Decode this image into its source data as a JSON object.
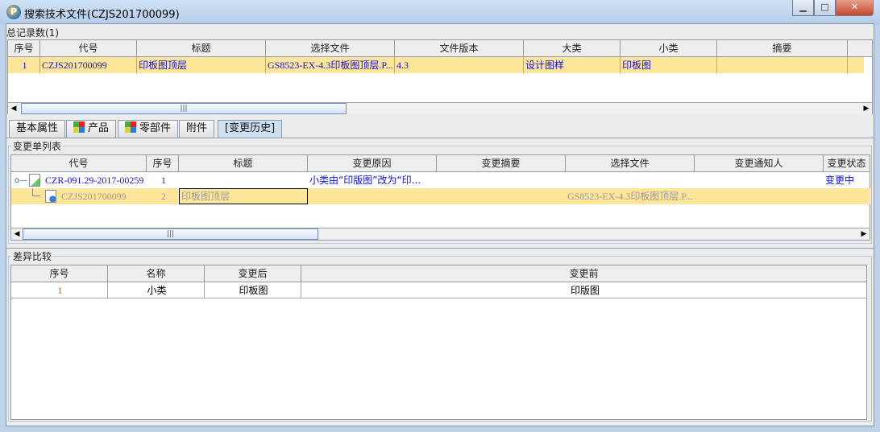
{
  "window": {
    "title": "搜索技术文件(CZJS201700099)",
    "minimize": "▁",
    "maximize": "□",
    "close": "✕"
  },
  "record_count": "总记录数(1)",
  "top_table": {
    "headers": [
      "序号",
      "代号",
      "标题",
      "选择文件",
      "文件版本",
      "大类",
      "小类",
      "摘要"
    ],
    "rows": [
      {
        "index": "1",
        "code": "CZJS201700099",
        "title": "印板图顶层",
        "file": "GS8523-EX-4.3印板图顶层.P...",
        "version": "4.3",
        "category": "设计图样",
        "subcategory": "印板图",
        "summary": ""
      }
    ]
  },
  "tabs": [
    {
      "label": "基本属性"
    },
    {
      "label": "产品"
    },
    {
      "label": "零部件"
    },
    {
      "label": "附件"
    },
    {
      "label": "[变更历史]"
    }
  ],
  "change_list": {
    "group_label": "变更单列表",
    "headers": [
      "代号",
      "序号",
      "标题",
      "变更原因",
      "变更摘要",
      "选择文件",
      "变更通知人",
      "变更状态"
    ],
    "rows": [
      {
        "code": "CZR-091.29-2017-00259",
        "index": "1",
        "title": "",
        "reason": "小类由“印版图”改为“印...",
        "summary": "",
        "file": "",
        "notifier": "",
        "status": "变更中"
      },
      {
        "code": "CZJS201700099",
        "index": "2",
        "title": "印板图顶层",
        "reason": "",
        "summary": "",
        "file": "GS8523-EX-4.3印板图顶层.P...",
        "notifier": "",
        "status": ""
      }
    ]
  },
  "diff": {
    "group_label": "差异比较",
    "headers": [
      "序号",
      "名称",
      "变更后",
      "变更前"
    ],
    "rows": [
      {
        "index": "1",
        "name": "小类",
        "after": "印板图",
        "before": "印版图"
      }
    ]
  },
  "scroll": {
    "top_thumb": "|||",
    "mid_thumb": "|||",
    "left": "◀",
    "right": "▶"
  }
}
